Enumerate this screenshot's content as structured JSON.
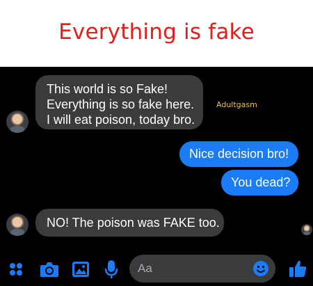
{
  "header": {
    "title": "Everything is fake"
  },
  "watermark": "Adultgasm",
  "messages": {
    "m1": {
      "lines": [
        "This world is so Fake!",
        "Everything is so fake here.",
        "I will eat poison, today bro."
      ]
    },
    "m2": {
      "text": "Nice decision bro!"
    },
    "m3": {
      "text": "You dead?"
    },
    "m4": {
      "text": "NO! The poison was FAKE too."
    }
  },
  "composer": {
    "placeholder": "Aa",
    "icons": [
      "more-icon",
      "camera-icon",
      "gallery-icon",
      "microphone-icon",
      "emoji-icon",
      "like-icon"
    ]
  },
  "colors": {
    "title": "#e0201b",
    "outgoing_bubble": "#1a7cf7",
    "incoming_bubble": "#3a3b3d",
    "chat_background": "#000000",
    "accent": "#1a7cf7"
  }
}
